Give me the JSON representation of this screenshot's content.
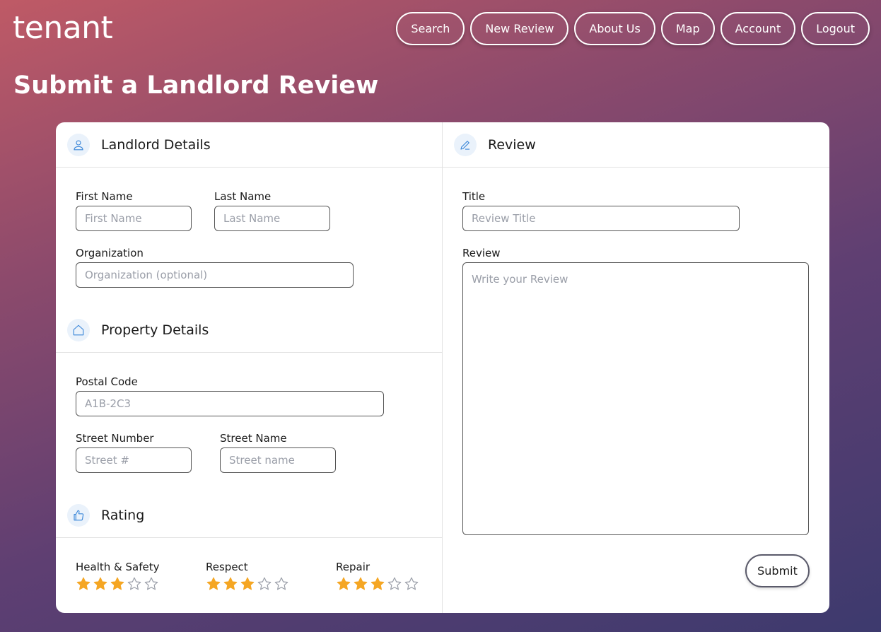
{
  "app": {
    "logo": "tenant",
    "page_title": "Submit a Landlord Review"
  },
  "nav": [
    "Search",
    "New Review",
    "About Us",
    "Map",
    "Account",
    "Logout"
  ],
  "landlord": {
    "title": "Landlord Details",
    "icon": "user-icon",
    "first_name_label": "First Name",
    "first_name_placeholder": "First Name",
    "last_name_label": "Last Name",
    "last_name_placeholder": "Last Name",
    "org_label": "Organization",
    "org_placeholder": "Organization (optional)"
  },
  "property": {
    "title": "Property Details",
    "icon": "home-icon",
    "postal_label": "Postal Code",
    "postal_placeholder": "A1B-2C3",
    "street_number_label": "Street Number",
    "street_number_placeholder": "Street #",
    "street_name_label": "Street Name",
    "street_name_placeholder": "Street name"
  },
  "rating": {
    "title": "Rating",
    "icon": "thumbs-up-icon",
    "categories": [
      {
        "label": "Health & Safety",
        "value": 3,
        "max": 5
      },
      {
        "label": "Respect",
        "value": 3,
        "max": 5
      },
      {
        "label": "Repair",
        "value": 3,
        "max": 5
      }
    ]
  },
  "review": {
    "title": "Review",
    "icon": "pencil-icon",
    "title_label": "Title",
    "title_placeholder": "Review Title",
    "review_label": "Review",
    "review_placeholder": "Write your Review",
    "submit_label": "Submit"
  },
  "colors": {
    "star_filled": "#f5a623",
    "star_empty": "#9a9ea8",
    "icon_accent": "#3a86d8"
  }
}
